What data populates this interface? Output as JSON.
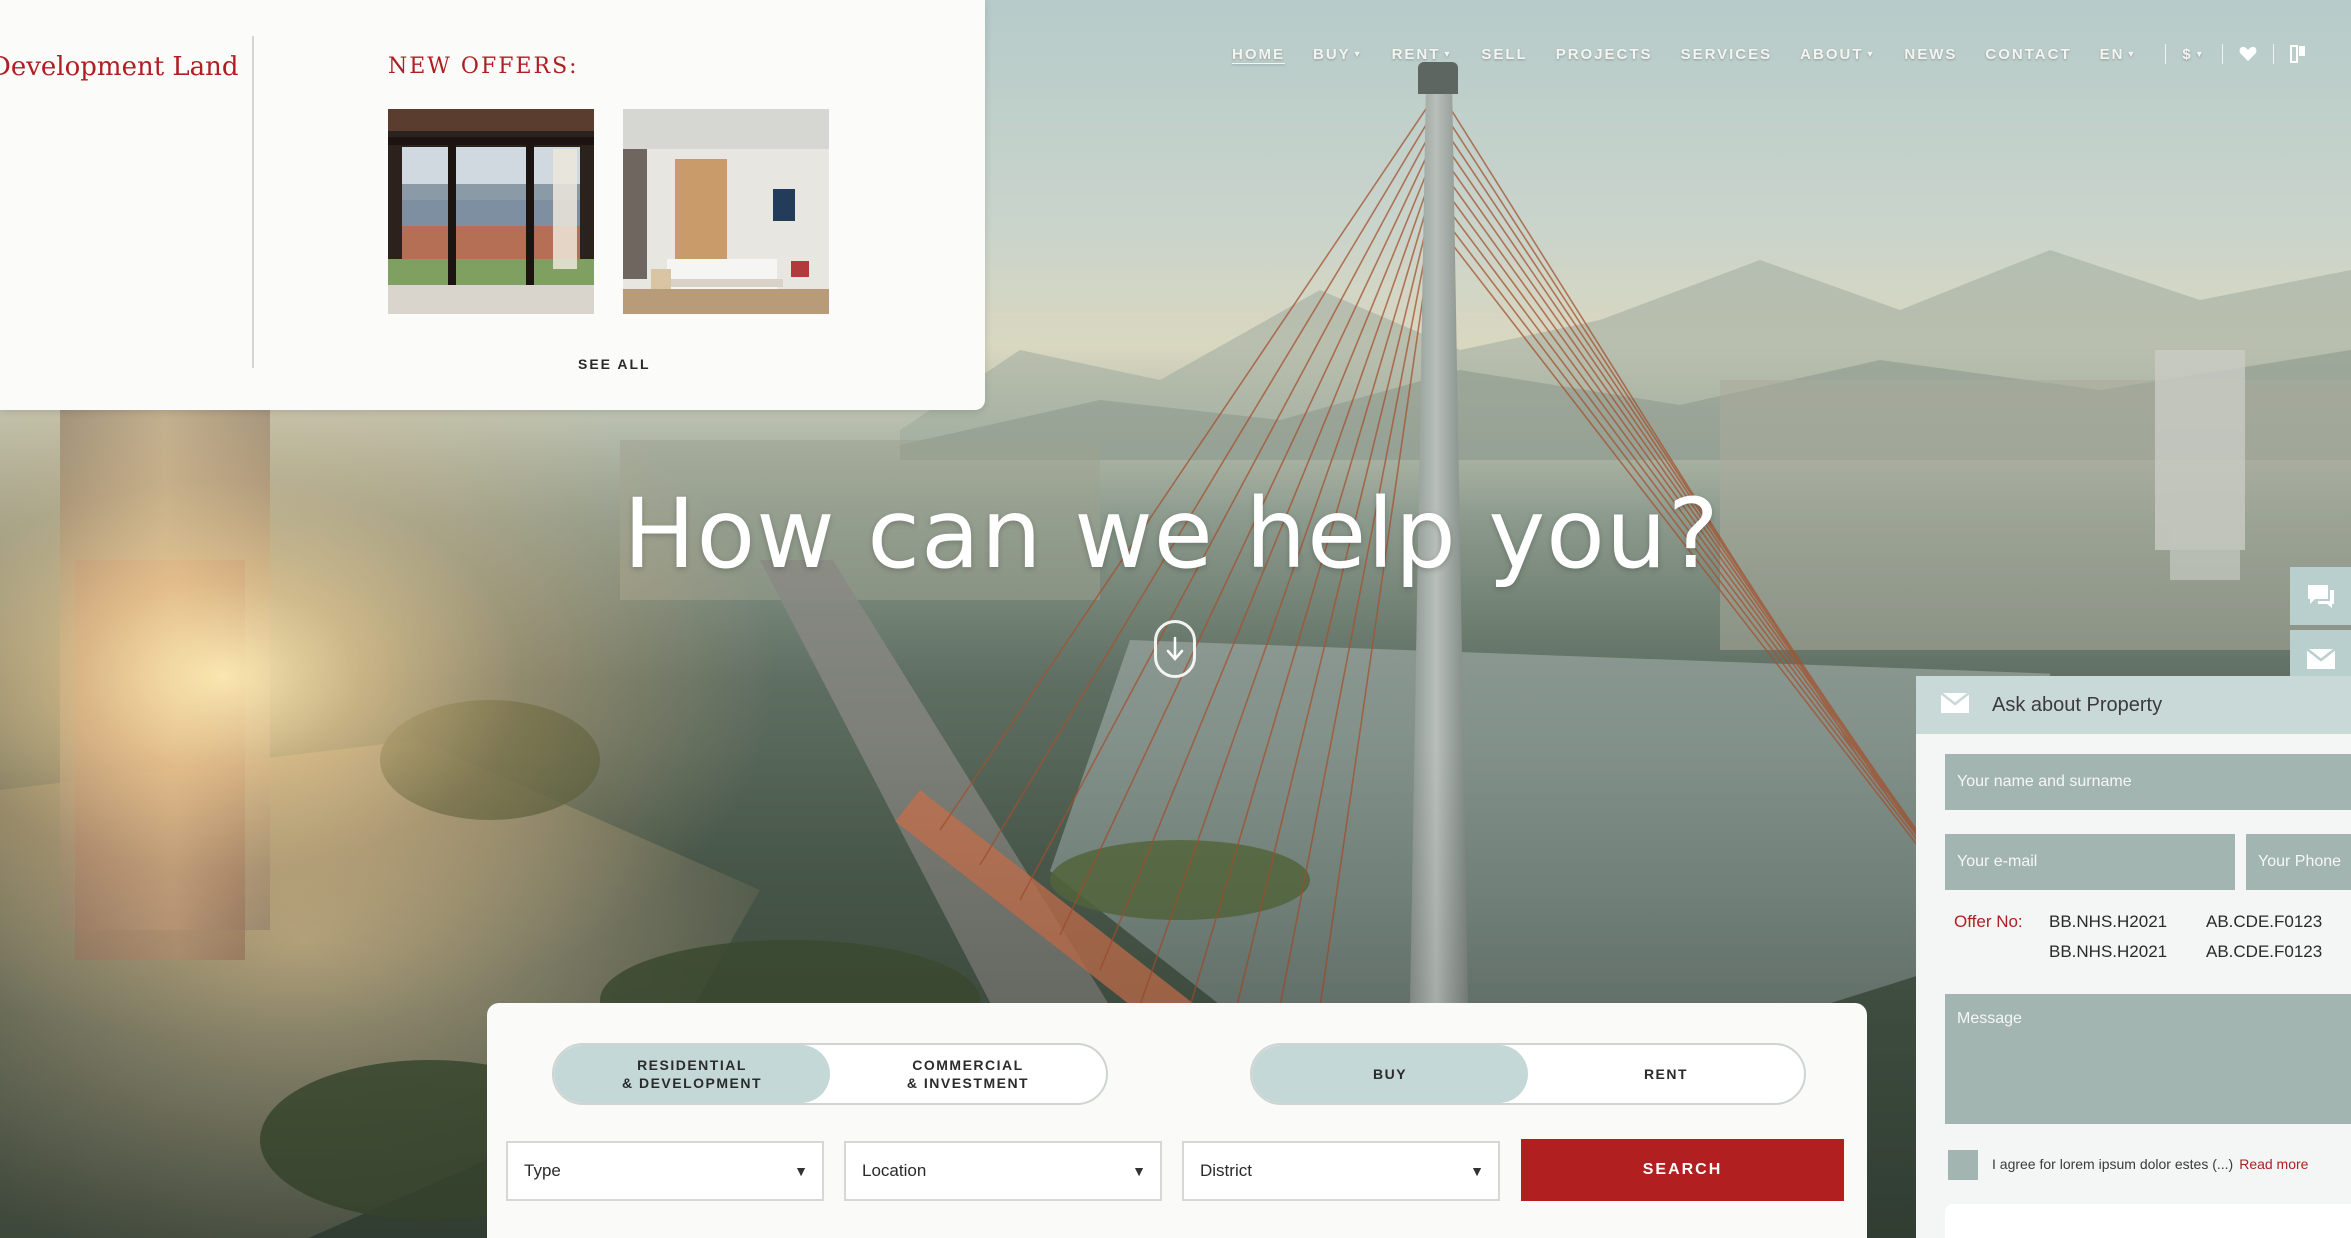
{
  "nav": {
    "items": [
      {
        "label": "HOME",
        "caret": false,
        "active": true
      },
      {
        "label": "BUY",
        "caret": true,
        "active": false
      },
      {
        "label": "RENT",
        "caret": true,
        "active": false
      },
      {
        "label": "SELL",
        "caret": false,
        "active": false
      },
      {
        "label": "PROJECTS",
        "caret": false,
        "active": false
      },
      {
        "label": "SERVICES",
        "caret": false,
        "active": false
      },
      {
        "label": "ABOUT",
        "caret": true,
        "active": false
      },
      {
        "label": "NEWS",
        "caret": false,
        "active": false
      },
      {
        "label": "CONTACT",
        "caret": false,
        "active": false
      }
    ],
    "language": "EN",
    "currency": "$",
    "icons": [
      "heart-icon",
      "compare-icon"
    ]
  },
  "dropdown": {
    "category_title": "Development Land",
    "new_offers_label": "NEW OFFERS:",
    "see_all_label": "SEE ALL"
  },
  "hero": {
    "title": "How can we help you?",
    "scroll_icon": "arrow-down-icon"
  },
  "search": {
    "segment_tabs": [
      {
        "label": "RESIDENTIAL\n& DEVELOPMENT",
        "selected": true
      },
      {
        "label": "COMMERCIAL\n& INVESTMENT",
        "selected": false
      }
    ],
    "mode_tabs": [
      {
        "label": "BUY",
        "selected": true
      },
      {
        "label": "RENT",
        "selected": false
      }
    ],
    "filters": [
      {
        "value": "Type"
      },
      {
        "value": "Location"
      },
      {
        "value": "District"
      }
    ],
    "button_label": "SEARCH"
  },
  "side_icons": [
    "chat-icon",
    "mail-icon"
  ],
  "ask_panel": {
    "title": "Ask about Property",
    "name_placeholder": "Your name and surname",
    "email_placeholder": "Your e-mail",
    "phone_placeholder": "Your Phone",
    "offer_label": "Offer No:",
    "offer_codes": [
      "BB.NHS.H2021",
      "AB.CDE.F0123",
      "BB.NHS.H2021",
      "AB.CDE.F0123"
    ],
    "message_placeholder": "Message",
    "agree_text": "I agree for lorem ipsum dolor estes (...)",
    "read_more": "Read more"
  },
  "colors": {
    "brand_red": "#b01e24",
    "accent_teal": "#c4d8d7",
    "field_gray": "#a3b5b1"
  }
}
